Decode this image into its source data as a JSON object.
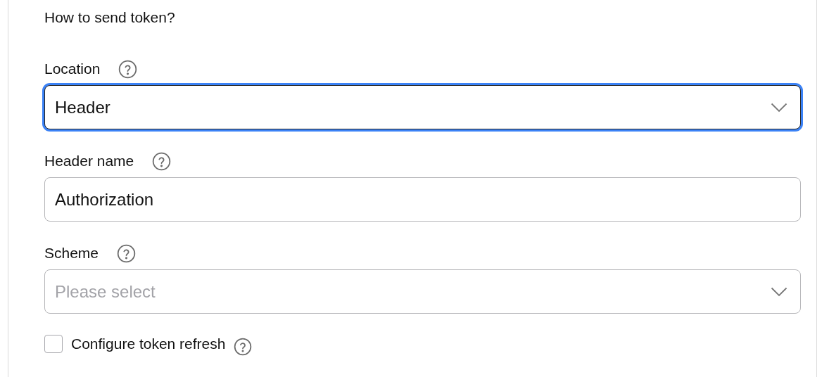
{
  "heading": "How to send token?",
  "fields": [
    {
      "kind": "select",
      "label": "Location",
      "value": "Header",
      "focused": true
    },
    {
      "kind": "text",
      "label": "Header name",
      "value": "Authorization",
      "focused": false
    },
    {
      "kind": "select",
      "label": "Scheme",
      "placeholder": "Please select",
      "focused": false
    }
  ],
  "checkbox": {
    "label": "Configure token refresh",
    "checked": false
  }
}
